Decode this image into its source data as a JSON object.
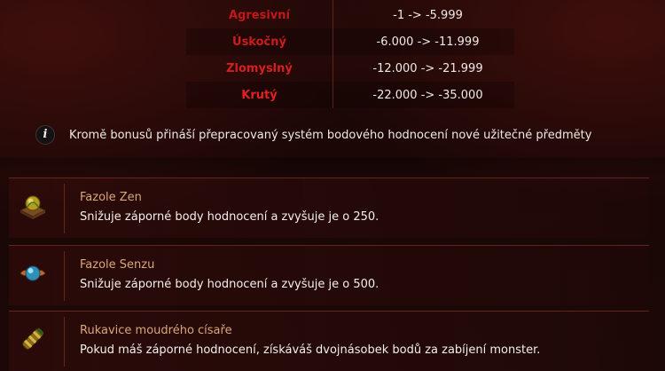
{
  "ranks": [
    {
      "name": "Agresivní",
      "range": "-1 -> -5.999",
      "color": "#c2181a"
    },
    {
      "name": "Úskočný",
      "range": "-6.000 -> -11.999",
      "color": "#cc1c1c"
    },
    {
      "name": "Zlomyslný",
      "range": "-12.000 -> -21.999",
      "color": "#d81e1e"
    },
    {
      "name": "Krutý",
      "range": "-22.000 -> -35.000",
      "color": "#e42020"
    }
  ],
  "info": {
    "icon": "info-icon",
    "glyph": "i",
    "text": "Kromě bonusů přináší přepracovaný systém bodového hodnocení nové užitečné předměty"
  },
  "items": [
    {
      "title": "Fazole Zen",
      "description": "Snižuje záporné body hodnocení a zvyšuje je o 250.",
      "icon": "zen-bean-icon"
    },
    {
      "title": "Fazole Senzu",
      "description": "Snižuje záporné body hodnocení a zvyšuje je o 500.",
      "icon": "senzu-bean-icon"
    },
    {
      "title": "Rukavice moudrého císaře",
      "description": "Pokud máš záporné hodnocení, získáváš dvojnásobek bodů za zabíjení monster.",
      "icon": "emperor-glove-icon"
    }
  ],
  "colors": {
    "item_title": "#d9a77a",
    "accent_border": "#963c2d"
  }
}
